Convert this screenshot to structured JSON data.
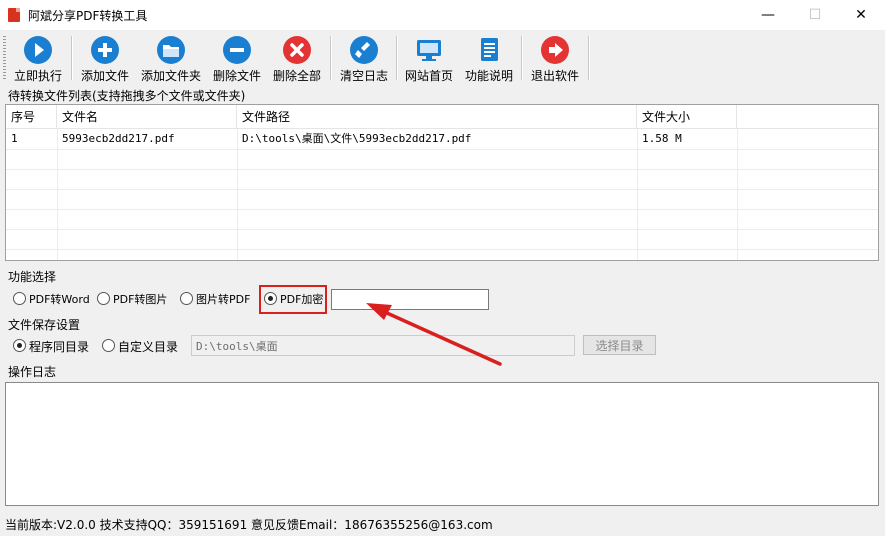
{
  "window": {
    "title": "阿斌分享PDF转换工具",
    "minimize_glyph": "—",
    "maximize_glyph": "☐",
    "close_glyph": "✕"
  },
  "toolbar": {
    "buttons": [
      {
        "label": "立即执行",
        "icon": "play-icon",
        "color": "#1a7fd1"
      },
      {
        "label": "添加文件",
        "icon": "plus-icon",
        "color": "#1a7fd1"
      },
      {
        "label": "添加文件夹",
        "icon": "folder-icon",
        "color": "#1a7fd1"
      },
      {
        "label": "删除文件",
        "icon": "minus-icon",
        "color": "#1a7fd1"
      },
      {
        "label": "删除全部",
        "icon": "x-icon",
        "color": "#e33333"
      },
      {
        "label": "清空日志",
        "icon": "broom-icon",
        "color": "#1a7fd1"
      },
      {
        "label": "网站首页",
        "icon": "monitor-icon",
        "color": "#1a7fd1"
      },
      {
        "label": "功能说明",
        "icon": "document-icon",
        "color": "#1a7fd1"
      },
      {
        "label": "退出软件",
        "icon": "exit-icon",
        "color": "#e33333"
      }
    ]
  },
  "file_list": {
    "section_label": "待转换文件列表(支持拖拽多个文件或文件夹)",
    "columns": [
      "序号",
      "文件名",
      "文件路径",
      "文件大小"
    ],
    "rows": [
      [
        "1",
        "5993ecb2dd217.pdf",
        "D:\\tools\\桌面\\文件\\5993ecb2dd217.pdf",
        "1.58 M"
      ]
    ]
  },
  "function_select": {
    "section_label": "功能选择",
    "options": [
      "PDF转Word",
      "PDF转图片",
      "图片转PDF",
      "PDF加密"
    ],
    "selected": "PDF加密",
    "password_value": ""
  },
  "save_settings": {
    "section_label": "文件保存设置",
    "options": [
      "程序同目录",
      "自定义目录"
    ],
    "selected": "程序同目录",
    "path_value": "D:\\tools\\桌面",
    "choose_label": "选择目录"
  },
  "log": {
    "section_label": "操作日志",
    "content": ""
  },
  "status_bar": {
    "text": "当前版本:V2.0.0  技术支持QQ：359151691  意见反馈Email：18676355256@163.com"
  },
  "annotation": {
    "highlight_color": "#d9201e"
  }
}
